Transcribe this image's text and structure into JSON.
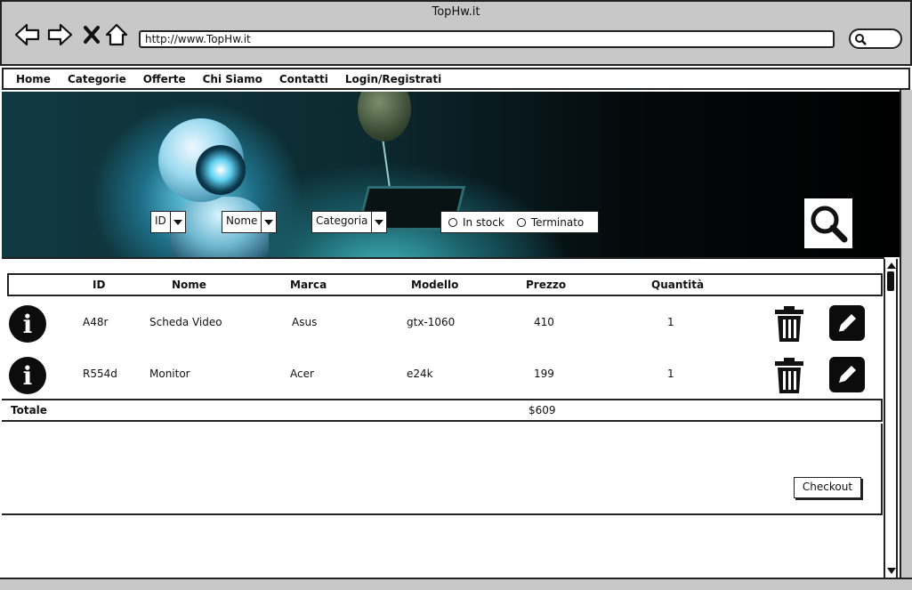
{
  "window": {
    "title": "TopHw.it"
  },
  "browser": {
    "url": "http://www.TopHw.it"
  },
  "menu": [
    "Home",
    "Categorie",
    "Offerte",
    "Chi Siamo",
    "Contatti",
    "Login/Registrati"
  ],
  "filters": {
    "id": "ID",
    "nome": "Nome",
    "categoria": "Categoria",
    "stock_options": [
      "In stock",
      "Terminato"
    ]
  },
  "table": {
    "headers": [
      "ID",
      "Nome",
      "Marca",
      "Modello",
      "Prezzo",
      "Quantità"
    ],
    "rows": [
      {
        "id": "A48r",
        "nome": "Scheda Video",
        "marca": "Asus",
        "modello": "gtx-1060",
        "prezzo": "410",
        "quantita": "1"
      },
      {
        "id": "R554d",
        "nome": "Monitor",
        "marca": "Acer",
        "modello": "e24k",
        "prezzo": "199",
        "quantita": "1"
      }
    ]
  },
  "total": {
    "label": "Totale",
    "value": "$609"
  },
  "checkout": {
    "label": "Checkout"
  },
  "icons": [
    "back-arrow-icon",
    "forward-arrow-icon",
    "close-icon",
    "home-icon",
    "search-icon",
    "info-icon",
    "trash-icon",
    "edit-pencil-icon"
  ]
}
